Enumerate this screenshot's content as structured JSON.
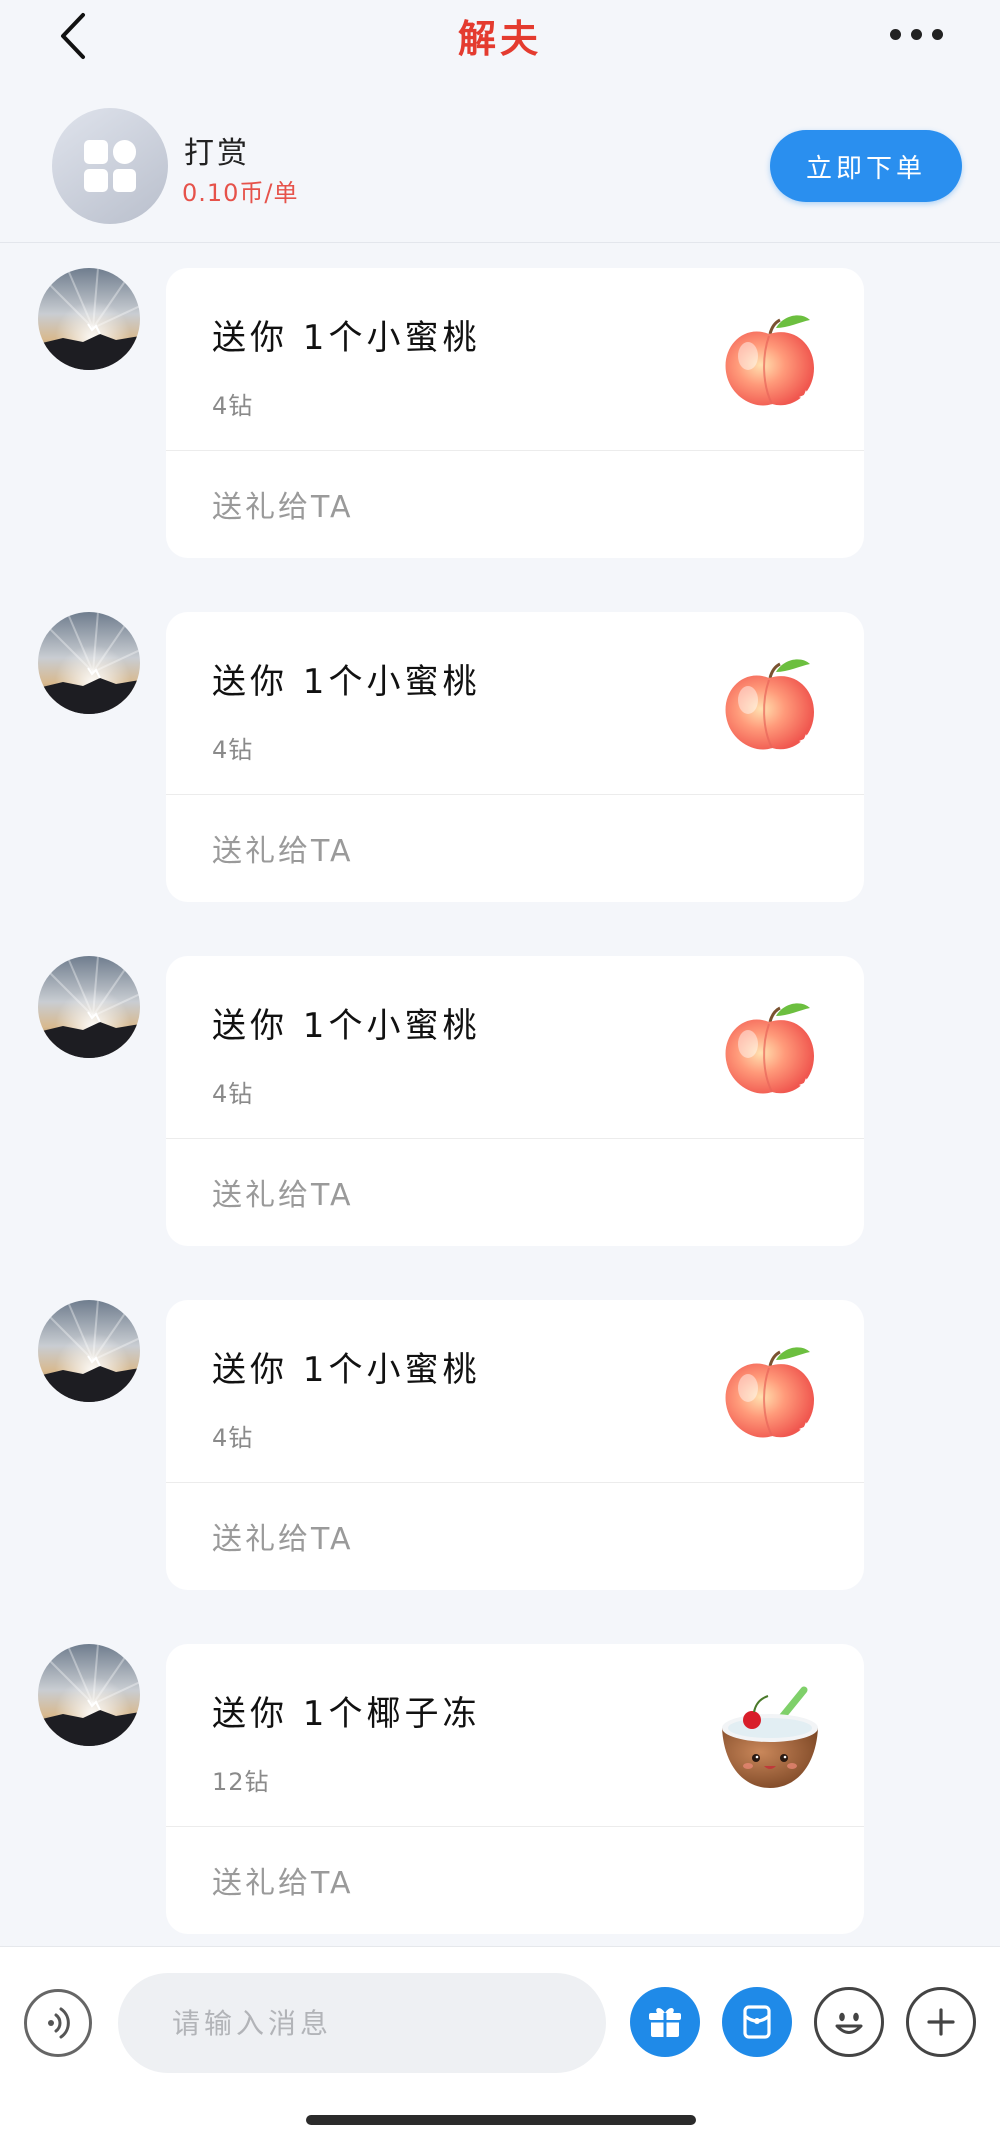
{
  "header": {
    "title": "解夫"
  },
  "order": {
    "service_name": "打赏",
    "price": "0.10币/单",
    "order_button": "立即下单"
  },
  "messages": [
    {
      "title": "送你 1个小蜜桃",
      "price": "4钻",
      "action": "送礼给TA",
      "gift_icon": "peach"
    },
    {
      "title": "送你 1个小蜜桃",
      "price": "4钻",
      "action": "送礼给TA",
      "gift_icon": "peach"
    },
    {
      "title": "送你 1个小蜜桃",
      "price": "4钻",
      "action": "送礼给TA",
      "gift_icon": "peach"
    },
    {
      "title": "送你 1个小蜜桃",
      "price": "4钻",
      "action": "送礼给TA",
      "gift_icon": "peach"
    },
    {
      "title": "送你 1个椰子冻",
      "price": "12钻",
      "action": "送礼给TA",
      "gift_icon": "coconut-jelly"
    }
  ],
  "input": {
    "placeholder": "请输入消息"
  },
  "icons": {
    "back": "chevron-left-icon",
    "more": "more-dots-icon",
    "voice": "voice-icon",
    "gift": "gift-icon",
    "red_packet": "red-packet-icon",
    "emoji": "emoji-icon",
    "plus": "plus-icon"
  },
  "colors": {
    "title": "#e43b2f",
    "accent": "#2a8fef",
    "price": "#e6524a"
  }
}
